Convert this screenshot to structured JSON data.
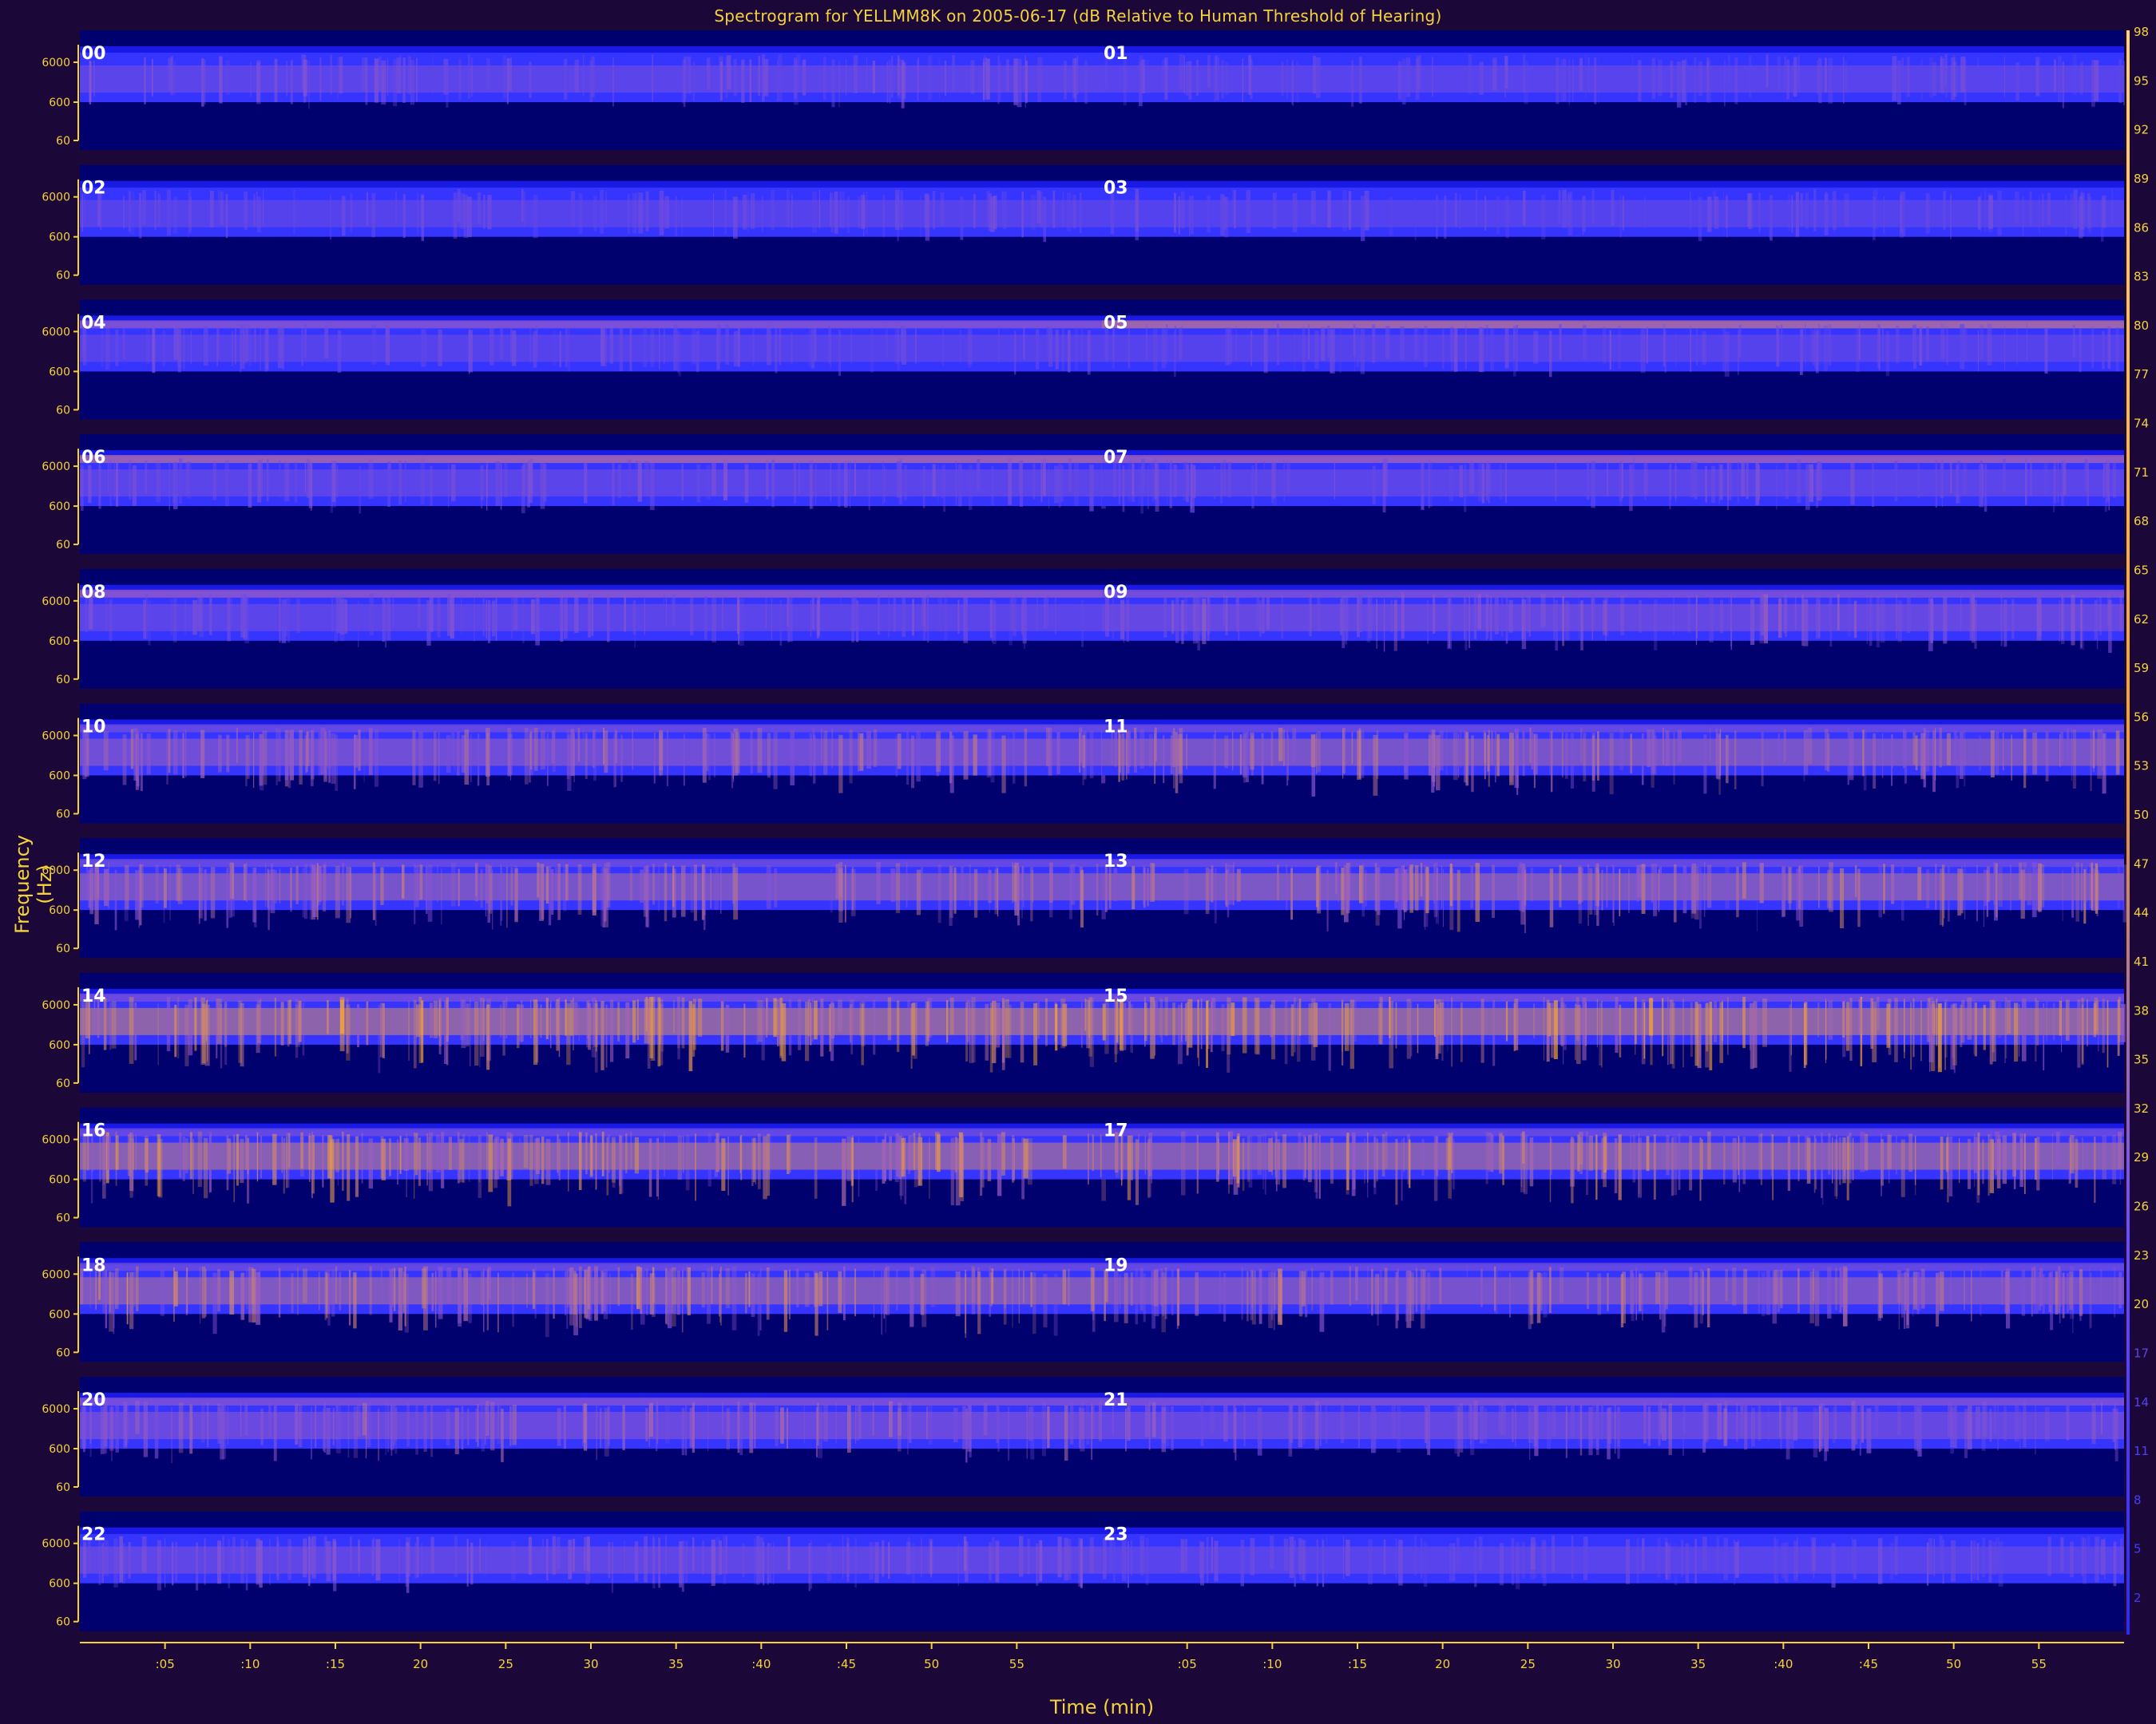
{
  "chart_data": {
    "type": "heatmap",
    "title": "Spectrogram for YELLMM8K on 2005-06-17 (dB Relative to Human Threshold of Hearing)",
    "xlabel": "Time (min)",
    "ylabel": "Frequency (Hz)",
    "panel_labels": [
      "00",
      "01",
      "02",
      "03",
      "04",
      "05",
      "06",
      "07",
      "08",
      "09",
      "10",
      "11",
      "12",
      "13",
      "14",
      "15",
      "16",
      "17",
      "18",
      "19",
      "20",
      "21",
      "22",
      "23"
    ],
    "y_ticks": [
      "6000",
      "600",
      "60"
    ],
    "x_ticks": [
      ":05",
      ":10",
      ":15",
      "20",
      "25",
      "30",
      "35",
      ":40",
      ":45",
      "50",
      "55",
      ":05",
      ":10",
      ":15",
      "20",
      "25",
      "30",
      "35",
      ":40",
      ":45",
      "50",
      "55"
    ],
    "colorbar_ticks": [
      98,
      95,
      92,
      89,
      86,
      83,
      80,
      77,
      74,
      71,
      68,
      65,
      62,
      59,
      56,
      53,
      50,
      47,
      44,
      41,
      38,
      35,
      32,
      29,
      26,
      23,
      20,
      17,
      14,
      11,
      8,
      5,
      2
    ],
    "colors": {
      "background": "#1c0838",
      "low": "#00006e",
      "mid": "#3a3aff",
      "high": "#ffaa22",
      "text": "#f3d23c",
      "panel_label": "#ffffff"
    },
    "band_intensity_by_hour": [
      {
        "hour": "00",
        "low_band": 0.35,
        "high_band": 0.05
      },
      {
        "hour": "01",
        "low_band": 0.32,
        "high_band": 0.05
      },
      {
        "hour": "02",
        "low_band": 0.3,
        "high_band": 0.05
      },
      {
        "hour": "03",
        "low_band": 0.28,
        "high_band": 0.05
      },
      {
        "hour": "04",
        "low_band": 0.3,
        "high_band": 0.45
      },
      {
        "hour": "05",
        "low_band": 0.3,
        "high_band": 0.65
      },
      {
        "hour": "06",
        "low_band": 0.35,
        "high_band": 0.6
      },
      {
        "hour": "07",
        "low_band": 0.35,
        "high_band": 0.55
      },
      {
        "hour": "08",
        "low_band": 0.35,
        "high_band": 0.5
      },
      {
        "hour": "09",
        "low_band": 0.45,
        "high_band": 0.4
      },
      {
        "hour": "10",
        "low_band": 0.55,
        "high_band": 0.3
      },
      {
        "hour": "11",
        "low_band": 0.62,
        "high_band": 0.3
      },
      {
        "hour": "12",
        "low_band": 0.62,
        "high_band": 0.3
      },
      {
        "hour": "13",
        "low_band": 0.65,
        "high_band": 0.3
      },
      {
        "hour": "14",
        "low_band": 0.8,
        "high_band": 0.35
      },
      {
        "hour": "15",
        "low_band": 0.8,
        "high_band": 0.35
      },
      {
        "hour": "16",
        "low_band": 0.75,
        "high_band": 0.3
      },
      {
        "hour": "17",
        "low_band": 0.72,
        "high_band": 0.3
      },
      {
        "hour": "18",
        "low_band": 0.68,
        "high_band": 0.3
      },
      {
        "hour": "19",
        "low_band": 0.6,
        "high_band": 0.3
      },
      {
        "hour": "20",
        "low_band": 0.5,
        "high_band": 0.4
      },
      {
        "hour": "21",
        "low_band": 0.45,
        "high_band": 0.4
      },
      {
        "hour": "22",
        "low_band": 0.4,
        "high_band": 0.1
      },
      {
        "hour": "23",
        "low_band": 0.32,
        "high_band": 0.05
      }
    ]
  }
}
